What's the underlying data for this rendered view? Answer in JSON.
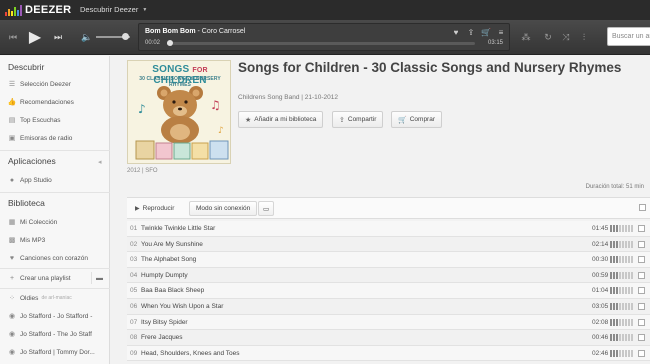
{
  "brand": {
    "name": "DEEZER",
    "bar_colors": [
      "#e8433d",
      "#f5a623",
      "#f8e71c",
      "#7ed321",
      "#4a90e2",
      "#9b59b6"
    ]
  },
  "topnav": {
    "menu_label": "Descubrir Deezer"
  },
  "player": {
    "track_title": "Bom Bom Bom",
    "track_artist": " - Coro Carrosel",
    "time_current": "00:02",
    "time_total": "03:15",
    "progress": 0.01,
    "volume": 0.85,
    "search_placeholder": "Buscar un artista, u"
  },
  "sidebar": {
    "discover_heading": "Descubrir",
    "discover_items": [
      {
        "label": "Selección Deezer",
        "icon": "list-icon"
      },
      {
        "label": "Recomendaciones",
        "icon": "thumb-icon"
      },
      {
        "label": "Top Escuchas",
        "icon": "chart-icon"
      },
      {
        "label": "Emisoras de radio",
        "icon": "radio-icon"
      }
    ],
    "apps_heading": "Aplicaciones",
    "apps_items": [
      {
        "label": "App Studio",
        "icon": "app-icon"
      }
    ],
    "library_heading": "Biblioteca",
    "library_items": [
      {
        "label": "Mi Colección",
        "icon": "collection-icon"
      },
      {
        "label": "Mis MP3",
        "icon": "mp3-icon"
      },
      {
        "label": "Canciones con corazón",
        "icon": "heart-icon"
      }
    ],
    "create_playlist": "Crear una playlist",
    "playlists": [
      {
        "label": "Oldies",
        "sub": "de arl-maniac"
      },
      {
        "label": "Jo Stafford - Jo Stafford -"
      },
      {
        "label": "Jo Stafford - The Jo Staff"
      },
      {
        "label": "Jo Stafford | Tommy Dor..."
      }
    ]
  },
  "album": {
    "title": "Songs for Children - 30 Classic Songs and Nursery Rhymes",
    "artist_line": "Childrens Song Band | 21-10-2012",
    "cover_meta": "2012 | SFO",
    "cover_title_a": "SONGS",
    "cover_title_b": "FOR",
    "cover_title_c": "CHILDREN",
    "cover_subtitle": "30 CLASSIC SONGS & NURSERY RHYMES",
    "btn_add": "Añadir a mi biblioteca",
    "btn_share": "Compartir",
    "btn_buy": "Comprar",
    "duration_total": "Duración total: 51 min",
    "btn_play": "Reproducir",
    "btn_offline": "Modo sin conexión"
  },
  "tracks": [
    {
      "num": "01",
      "title": "Twinkle Twinkle Little Star",
      "duration": "01:45",
      "popularity": 0.4
    },
    {
      "num": "02",
      "title": "You Are My Sunshine",
      "duration": "02:14",
      "popularity": 0.4
    },
    {
      "num": "03",
      "title": "The Alphabet Song",
      "duration": "00:30",
      "popularity": 0.4
    },
    {
      "num": "04",
      "title": "Humpty Dumpty",
      "duration": "00:59",
      "popularity": 0.4
    },
    {
      "num": "05",
      "title": "Baa Baa Black Sheep",
      "duration": "01:04",
      "popularity": 0.4
    },
    {
      "num": "06",
      "title": "When You Wish Upon a Star",
      "duration": "03:05",
      "popularity": 0.4
    },
    {
      "num": "07",
      "title": "Itsy Bitsy Spider",
      "duration": "02:08",
      "popularity": 0.4
    },
    {
      "num": "08",
      "title": "Frere Jacques",
      "duration": "00:46",
      "popularity": 0.4
    },
    {
      "num": "09",
      "title": "Head, Shoulders, Knees and Toes",
      "duration": "02:46",
      "popularity": 0.4
    }
  ]
}
